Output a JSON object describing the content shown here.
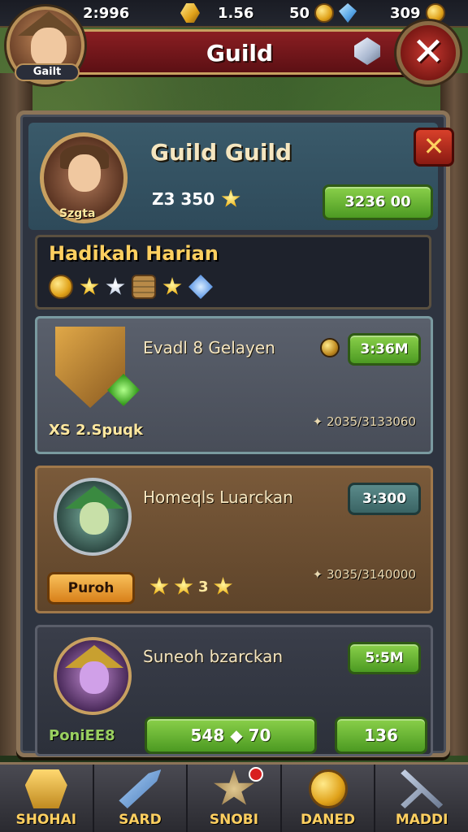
{
  "topbar": {
    "res1": "2:996",
    "res2": "1.56",
    "res3": "50",
    "res4": "309"
  },
  "header": {
    "title": "Guild",
    "avatar_tag": "Gailt"
  },
  "guild": {
    "title": "Guild Guild",
    "level": "Z3 350",
    "emblem_label": "Szgta",
    "button": "3236 00"
  },
  "rewards": {
    "title": "Hadikah Harian"
  },
  "cards": [
    {
      "title": "Evadl 8 Gelayen",
      "sub": "XS 2.Spuqk",
      "button": "3:36M",
      "progress": "✦ 2035/3133060"
    },
    {
      "title": "Homeqls Luarckan",
      "button": "3:300",
      "progress": "✦ 3035/3140000",
      "action": "Puroh",
      "stars_label": "3"
    },
    {
      "title": "Suneoh bzarckan",
      "sub": "PoniEE8",
      "button": "5:5M",
      "buy_label": "548 ◆ 70",
      "buy2_label": "136"
    }
  ],
  "nav": [
    {
      "label": "SHOHAI",
      "icon": "shop-icon"
    },
    {
      "label": "SARD",
      "icon": "sword-icon"
    },
    {
      "label": "SNOBI",
      "icon": "star-icon"
    },
    {
      "label": "DANED",
      "icon": "coin-icon"
    },
    {
      "label": "MADDI",
      "icon": "tools-icon"
    }
  ]
}
